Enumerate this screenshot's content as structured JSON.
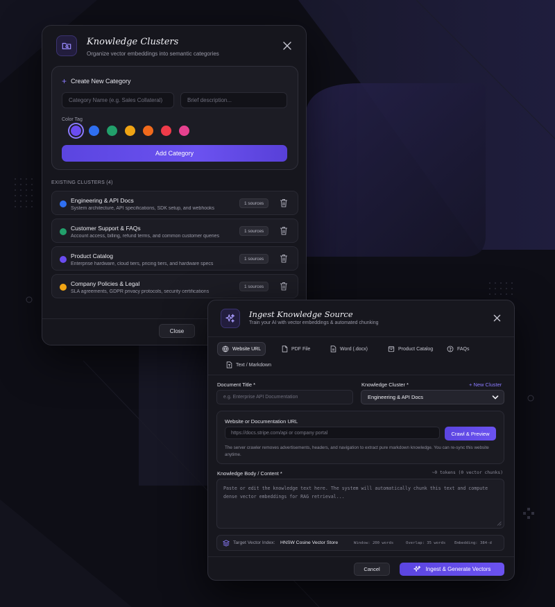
{
  "clusters_modal": {
    "title": "Knowledge Clusters",
    "subtitle": "Organize vector embeddings into semantic categories",
    "create": {
      "heading": "Create New Category",
      "name_placeholder": "Category Name (e.g. Sales Collateral)",
      "desc_placeholder": "Brief description...",
      "color_label": "Color Tag",
      "colors": [
        "#6a4cf0",
        "#2f6ff0",
        "#22a06b",
        "#f0a414",
        "#f06a1c",
        "#ef3b4a",
        "#e6418f"
      ],
      "selected_color": "#6a4cf0",
      "add_label": "Add Category"
    },
    "existing_label": "EXISTING CLUSTERS (4)",
    "clusters": [
      {
        "name": "Engineering & API Docs",
        "desc": "System architecture, API specifications, SDK setup, and webhooks",
        "sources": "1 sources",
        "color": "#2f6ff0"
      },
      {
        "name": "Customer Support & FAQs",
        "desc": "Account access, billing, refund terms, and common customer queries",
        "sources": "1 sources",
        "color": "#22a06b"
      },
      {
        "name": "Product Catalog",
        "desc": "Enterprise hardware, cloud tiers, pricing tiers, and hardware specs",
        "sources": "1 sources",
        "color": "#6a4cf0"
      },
      {
        "name": "Company Policies & Legal",
        "desc": "SLA agreements, GDPR privacy protocols, security certifications",
        "sources": "1 sources",
        "color": "#f0a414"
      }
    ],
    "close_label": "Close"
  },
  "ingest_modal": {
    "title": "Ingest Knowledge Source",
    "subtitle": "Train your AI with vector embeddings & automated chunking",
    "tabs": [
      "Website URL",
      "PDF File",
      "Word (.docx)",
      "Product Catalog",
      "FAQs",
      "Text / Markdown"
    ],
    "active_tab": "Website URL",
    "doc_title_label": "Document Title *",
    "doc_title_placeholder": "e.g. Enterprise API Documentation",
    "cluster_label": "Knowledge Cluster *",
    "new_cluster_label": "+ New Cluster",
    "cluster_value": "Engineering & API Docs",
    "url_label": "Website or Documentation URL",
    "url_placeholder": "https://docs.stripe.com/api or company portal",
    "crawl_label": "Crawl & Preview",
    "url_help": "The server crawler removes advertisements, headers, and navigation to extract pure markdown knowledge. You can re-sync this website anytime.",
    "body_label": "Knowledge Body / Content *",
    "token_info": "~0 tokens (0 vector chunks)",
    "body_placeholder": "Paste or edit the knowledge text here. The system will automatically chunk this text and compute dense vector embeddings for RAG retrieval...",
    "vector_index_label": "Target Vector Index:",
    "vector_index_value": "HNSW Cosine Vector Store",
    "window": "Window: 200 words",
    "overlap": "Overlap: 35 words",
    "embedding": "Embedding: 384-d",
    "cancel_label": "Cancel",
    "ingest_label": "Ingest & Generate Vectors"
  }
}
